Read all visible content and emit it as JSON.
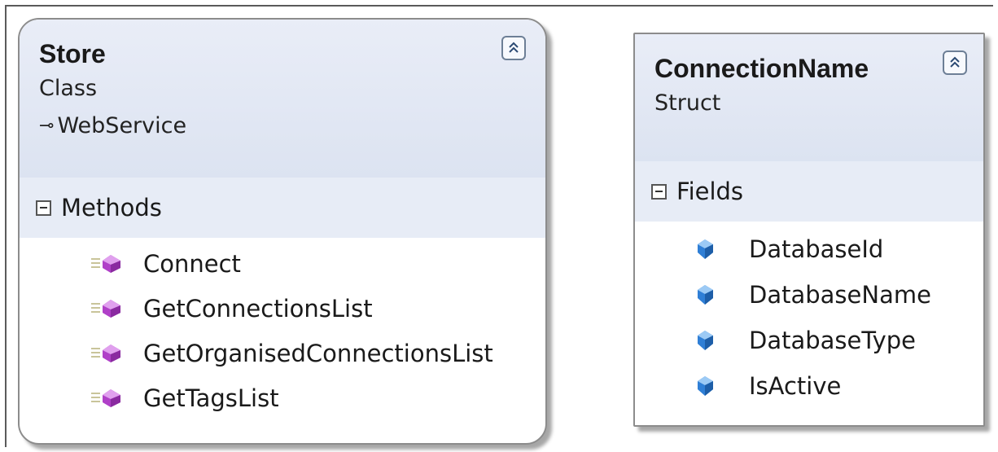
{
  "class_shape": {
    "name": "Store",
    "kind": "Class",
    "base_type": "WebService",
    "compartment_label": "Methods",
    "members": [
      {
        "name": "Connect",
        "icon": "method-icon"
      },
      {
        "name": "GetConnectionsList",
        "icon": "method-icon"
      },
      {
        "name": "GetOrganisedConnectionsList",
        "icon": "method-icon"
      },
      {
        "name": "GetTagsList",
        "icon": "method-icon"
      }
    ]
  },
  "struct_shape": {
    "name": "ConnectionName",
    "kind": "Struct",
    "compartment_label": "Fields",
    "members": [
      {
        "name": "DatabaseId",
        "icon": "field-icon"
      },
      {
        "name": "DatabaseName",
        "icon": "field-icon"
      },
      {
        "name": "DatabaseType",
        "icon": "field-icon"
      },
      {
        "name": "IsActive",
        "icon": "field-icon"
      }
    ]
  },
  "colors": {
    "header_bg": "#dce3f1",
    "compartment_bg": "#e7ecf6",
    "method_icon": "#b040c8",
    "field_icon": "#2f7fd6"
  }
}
